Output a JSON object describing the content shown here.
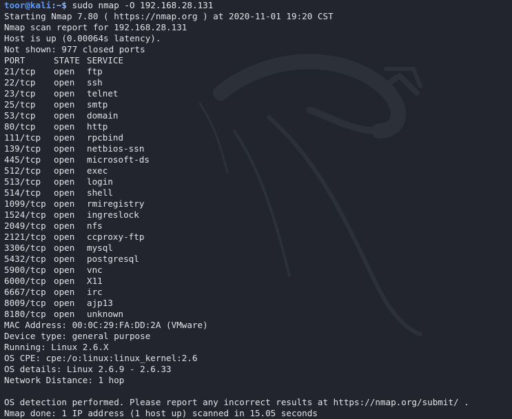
{
  "prompt": {
    "user_host": "toor@kali",
    "path": ":~$",
    "command": "sudo nmap -O 192.168.28.131"
  },
  "header_lines": [
    "Starting Nmap 7.80 ( https://nmap.org ) at 2020-11-01 19:20 CST",
    "Nmap scan report for 192.168.28.131",
    "Host is up (0.00064s latency).",
    "Not shown: 977 closed ports"
  ],
  "table": {
    "columns": [
      "PORT",
      "STATE",
      "SERVICE"
    ],
    "rows": [
      [
        "21/tcp",
        "open",
        "ftp"
      ],
      [
        "22/tcp",
        "open",
        "ssh"
      ],
      [
        "23/tcp",
        "open",
        "telnet"
      ],
      [
        "25/tcp",
        "open",
        "smtp"
      ],
      [
        "53/tcp",
        "open",
        "domain"
      ],
      [
        "80/tcp",
        "open",
        "http"
      ],
      [
        "111/tcp",
        "open",
        "rpcbind"
      ],
      [
        "139/tcp",
        "open",
        "netbios-ssn"
      ],
      [
        "445/tcp",
        "open",
        "microsoft-ds"
      ],
      [
        "512/tcp",
        "open",
        "exec"
      ],
      [
        "513/tcp",
        "open",
        "login"
      ],
      [
        "514/tcp",
        "open",
        "shell"
      ],
      [
        "1099/tcp",
        "open",
        "rmiregistry"
      ],
      [
        "1524/tcp",
        "open",
        "ingreslock"
      ],
      [
        "2049/tcp",
        "open",
        "nfs"
      ],
      [
        "2121/tcp",
        "open",
        "ccproxy-ftp"
      ],
      [
        "3306/tcp",
        "open",
        "mysql"
      ],
      [
        "5432/tcp",
        "open",
        "postgresql"
      ],
      [
        "5900/tcp",
        "open",
        "vnc"
      ],
      [
        "6000/tcp",
        "open",
        "X11"
      ],
      [
        "6667/tcp",
        "open",
        "irc"
      ],
      [
        "8009/tcp",
        "open",
        "ajp13"
      ],
      [
        "8180/tcp",
        "open",
        "unknown"
      ]
    ]
  },
  "footer_lines": [
    "MAC Address: 00:0C:29:FA:DD:2A (VMware)",
    "Device type: general purpose",
    "Running: Linux 2.6.X",
    "OS CPE: cpe:/o:linux:linux_kernel:2.6",
    "OS details: Linux 2.6.9 - 2.6.33",
    "Network Distance: 1 hop",
    "",
    "OS detection performed. Please report any incorrect results at https://nmap.org/submit/ .",
    "Nmap done: 1 IP address (1 host up) scanned in 15.05 seconds"
  ],
  "colors": {
    "background": "#22252d",
    "text": "#dfe2e8",
    "prompt_user": "#5b9bff",
    "watermark": "#2c3039"
  },
  "icons": {
    "watermark": "kali-dragon-icon"
  }
}
